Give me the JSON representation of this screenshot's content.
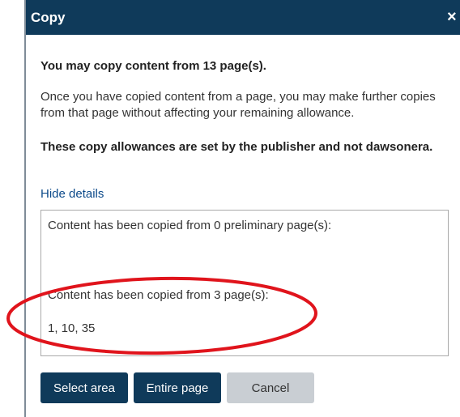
{
  "dialog": {
    "title": "Copy",
    "close_label": "×",
    "allowance_text": "You may copy content from 13 page(s).",
    "info_text": "Once you have copied content from a page, you may make further copies from that page without affecting your remaining allowance.",
    "notice_text": "These copy allowances are set by the publisher and not dawsonera.",
    "details_link": "Hide details",
    "details": {
      "preliminary_text": "Content has been copied from 0 preliminary page(s):",
      "pages_text": "Content has been copied from 3 page(s):",
      "pages_list": "1, 10, 35"
    },
    "buttons": {
      "select_area": "Select area",
      "entire_page": "Entire page",
      "cancel": "Cancel"
    }
  },
  "colors": {
    "titlebar": "#0f3a5a",
    "link": "#0c4a8a",
    "annotation": "#e0141c"
  }
}
